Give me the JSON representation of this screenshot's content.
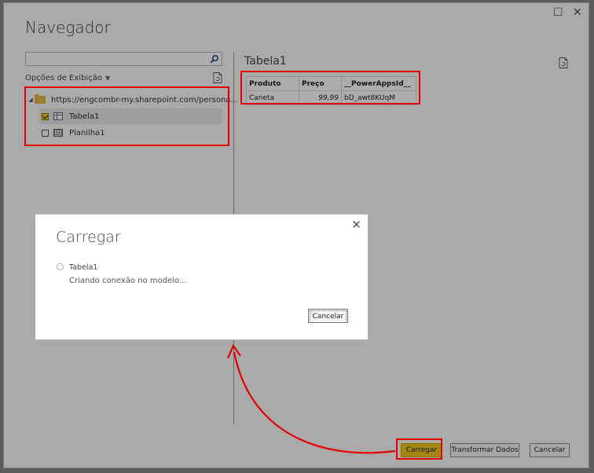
{
  "window": {
    "title": "Navegador",
    "maximize_glyph": "☐",
    "close_glyph": "✕"
  },
  "navigator": {
    "search": {
      "value": "",
      "placeholder": ""
    },
    "display_options": "Opções de Exibição",
    "tree": {
      "root": "https://engcombr-my.sharepoint.com/persona...",
      "items": [
        {
          "label": "Tabela1",
          "checked": true
        },
        {
          "label": "Planilha1",
          "checked": false
        }
      ]
    }
  },
  "preview": {
    "title": "Tabela1",
    "columns": [
      "Produto",
      "Preço",
      "__PowerAppsId__"
    ],
    "rows": [
      [
        "Caneta",
        "99,99",
        "bD_awt8KUqM"
      ]
    ]
  },
  "footer": {
    "load": "Carregar",
    "transform": "Transformar Dados",
    "cancel": "Cancelar"
  },
  "dialog": {
    "title": "Carregar",
    "item": "Tabela1",
    "status": "Criando conexão no modelo...",
    "cancel": "Cancelar",
    "close_glyph": "✕"
  },
  "colors": {
    "accent": "#f2c811",
    "highlight": "#e30000"
  },
  "icons": [
    "search-icon",
    "refresh-icon",
    "folder-icon",
    "table-icon",
    "sheet-icon",
    "spinner-icon",
    "close-icon",
    "maximize-icon"
  ]
}
